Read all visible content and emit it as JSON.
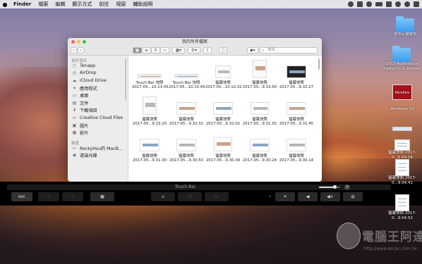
{
  "menubar": {
    "apple": "",
    "items": [
      "Finder",
      "檔案",
      "編輯",
      "顯示方式",
      "前往",
      "視窗",
      "輔助說明"
    ],
    "status_icons": [
      "cloud-icon",
      "volume-icon",
      "wifi-icon",
      "battery-icon",
      "display-icon",
      "spotlight-icon",
      "user-icon",
      "notifications-icon"
    ]
  },
  "finder": {
    "title": "我的所有檔案",
    "search_placeholder": "搜尋",
    "sidebar_heading_favorites": "喜好項目",
    "sidebar_heading_devices": "裝置",
    "sidebar_items": [
      {
        "label": "Tenapp",
        "icon": "app-icon"
      },
      {
        "label": "AirDrop",
        "icon": "airdrop-icon"
      },
      {
        "label": "iCloud Drive",
        "icon": "cloud-icon"
      },
      {
        "label": "應用程式",
        "icon": "apps-icon"
      },
      {
        "label": "桌面",
        "icon": "desktop-icon"
      },
      {
        "label": "文件",
        "icon": "document-icon"
      },
      {
        "label": "下載項目",
        "icon": "download-icon"
      },
      {
        "label": "Creative Cloud Files",
        "icon": "creative-cloud-icon"
      },
      {
        "label": "圖片",
        "icon": "pictures-icon"
      },
      {
        "label": "影片",
        "icon": "movies-icon"
      }
    ],
    "device_items": [
      {
        "label": "RockyHsu的 MacB...",
        "icon": "laptop-icon"
      },
      {
        "label": "遠端光碟",
        "icon": "disc-icon"
      }
    ],
    "files": [
      {
        "name": "Touch Bar 快照",
        "date": "2017-05...10.13.45"
      },
      {
        "name": "Touch Bar 快照",
        "date": "2017-05...10.10.45"
      },
      {
        "name": "螢幕快照",
        "date": "2017-05...10.10.32"
      },
      {
        "name": "螢幕快照",
        "date": "2017-05...9.33.50"
      },
      {
        "name": "螢幕快照",
        "date": "2017-05...9.33.27"
      },
      {
        "name": "螢幕快照",
        "date": "2017-05...9.33.20"
      },
      {
        "name": "螢幕快照",
        "date": "2017-05...9.32.32"
      },
      {
        "name": "螢幕快照",
        "date": "2017-05...9.32.02"
      },
      {
        "name": "螢幕快照",
        "date": "2017-05...9.31.55"
      },
      {
        "name": "螢幕快照",
        "date": "2017-05...9.31.45"
      },
      {
        "name": "螢幕快照",
        "date": "2017-05...9.31.30"
      },
      {
        "name": "螢幕快照",
        "date": "2017-05...9.30.50"
      },
      {
        "name": "螢幕快照",
        "date": "2017-05...9.30.39"
      },
      {
        "name": "螢幕快照",
        "date": "2017-05...9.30.24"
      },
      {
        "name": "螢幕快照",
        "date": "2017-05...9.30.14"
      }
    ]
  },
  "touchbar": {
    "title": "Touch Bar",
    "esc": "esc",
    "close": "×",
    "brightness_level": 0.75
  },
  "desktop": {
    "icons": [
      {
        "label": "未命名檔案夾",
        "type": "folder"
      },
      {
        "label": "2017 Australia's Easter S...e photos",
        "type": "folder"
      },
      {
        "label": "Parallels",
        "type": "app"
      },
      {
        "label": "Windows 10",
        "type": "label"
      },
      {
        "label": "螢幕快照 2017-0...6.04.06",
        "type": "doc"
      },
      {
        "label": "螢幕快照 2017-0...9.04.41",
        "type": "doc"
      },
      {
        "label": "螢幕快照 2017-0...9.04.52",
        "type": "doc"
      }
    ]
  },
  "watermark": {
    "text": "電腦王阿達",
    "sub": "http://www.kocpc.com.tw"
  }
}
